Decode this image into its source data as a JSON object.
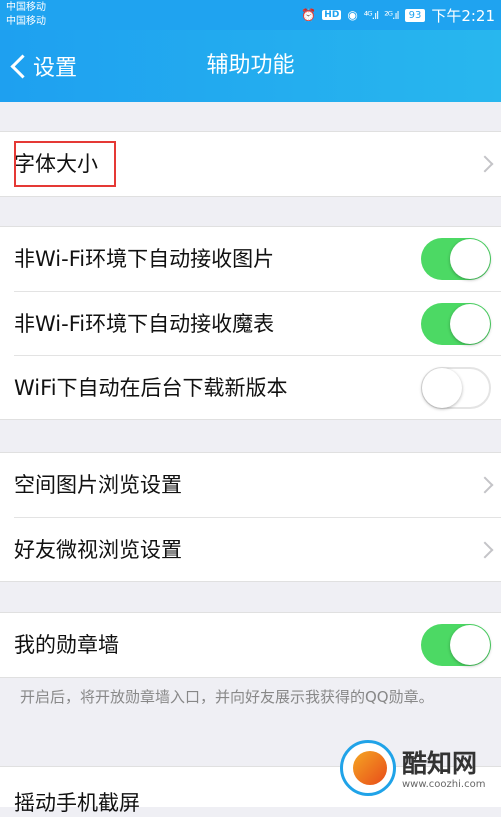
{
  "status": {
    "carrier_line1": "中国移动",
    "carrier_line2": "中国移动",
    "icons": [
      "alarm-icon",
      "hd-icon",
      "eye-icon",
      "signal-4g-icon",
      "signal-2g-icon",
      "battery-icon"
    ],
    "hd": "HD",
    "signal_4g": "⁴ᴳ.ıl",
    "signal_2g": "²ᴳ.ıl",
    "battery": "93",
    "time": "下午2:21"
  },
  "nav": {
    "back_label": "设置",
    "title": "辅助功能"
  },
  "groups": [
    {
      "rows": [
        {
          "label": "字体大小",
          "control": "chevron"
        }
      ]
    },
    {
      "rows": [
        {
          "label": "非Wi-Fi环境下自动接收图片",
          "control": "toggle",
          "on": true
        },
        {
          "label": "非Wi-Fi环境下自动接收魔表",
          "control": "toggle",
          "on": true
        },
        {
          "label": "WiFi下自动在后台下载新版本",
          "control": "toggle",
          "on": false
        }
      ]
    },
    {
      "rows": [
        {
          "label": "空间图片浏览设置",
          "control": "chevron"
        },
        {
          "label": "好友微视浏览设置",
          "control": "chevron"
        }
      ]
    },
    {
      "rows": [
        {
          "label": "我的勋章墙",
          "control": "toggle",
          "on": true
        }
      ]
    },
    {
      "rows": [
        {
          "label": "摇动手机截屏"
        }
      ]
    }
  ],
  "medal_footnote": "开启后，将开放勋章墙入口，并向好友展示我获得的QQ勋章。",
  "watermark": {
    "name": "酷知网",
    "url": "www.coozhi.com"
  },
  "colors": {
    "nav": "#1fa3f0",
    "toggle_on": "#4cd964",
    "highlight": "#e53935"
  }
}
